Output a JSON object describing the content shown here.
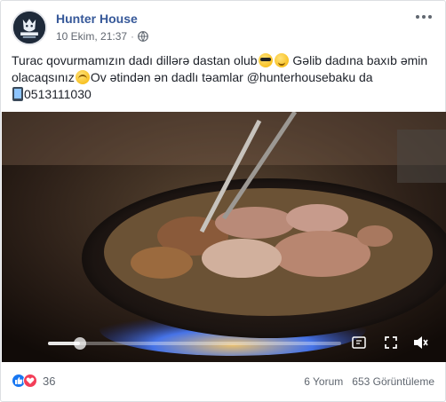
{
  "post": {
    "page_name": "Hunter House",
    "timestamp": "10 Ekim, 21:37",
    "separator": "·",
    "privacy_icon": "globe-icon",
    "text": {
      "line1_a": "Turac qovurmamızın dadı dillərə dastan olub",
      "line1_b": " Gəlib dadına baxıb əmin",
      "line2_a": "olacaqsınız",
      "line2_b": "Ov ətindən ən dadlı təamlar @hunterhousebaku da",
      "line3": "0513111030"
    },
    "emojis": [
      "sunglasses-emoji",
      "smile-emoji",
      "hugging-emoji",
      "mobile-phone-emoji"
    ]
  },
  "video": {
    "progress": 0.11,
    "icons": [
      "settings-icon",
      "fullscreen-icon",
      "mute-icon"
    ]
  },
  "footer": {
    "reaction_count": "36",
    "comments": "6 Yorum",
    "views": "653 Görüntüleme"
  }
}
